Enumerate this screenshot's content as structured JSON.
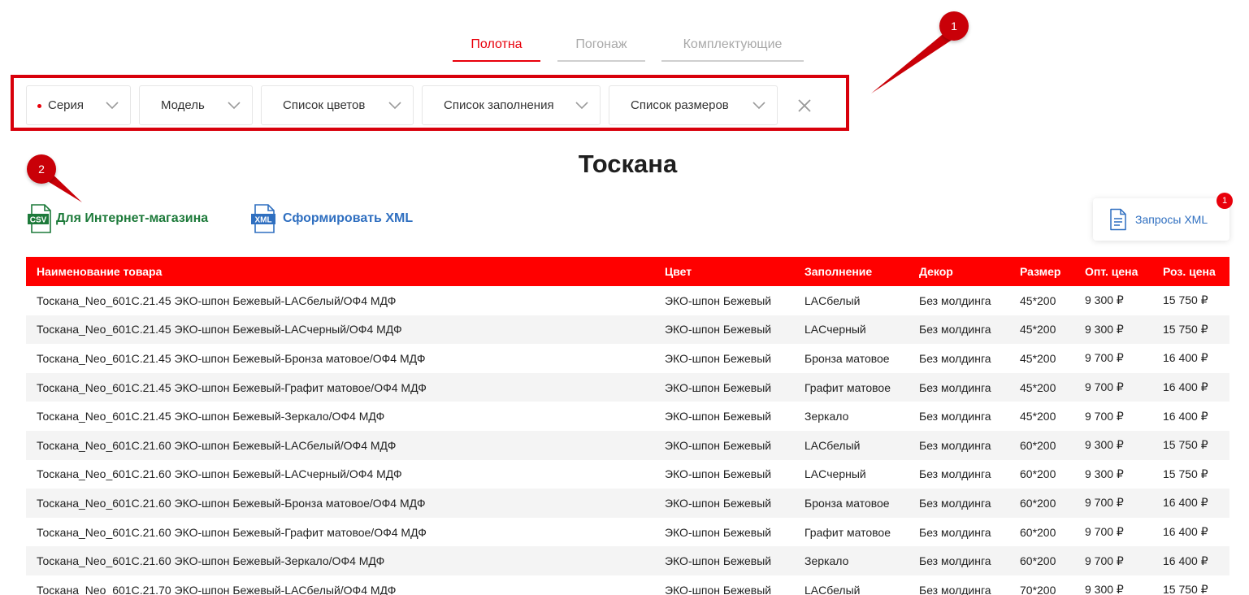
{
  "tabs": [
    {
      "label": "Полотна",
      "active": true
    },
    {
      "label": "Погонаж",
      "active": false
    },
    {
      "label": "Комплектующие",
      "active": false
    }
  ],
  "filters": [
    {
      "label": "Серия",
      "marked": true
    },
    {
      "label": "Модель",
      "marked": false
    },
    {
      "label": "Список цветов",
      "marked": false
    },
    {
      "label": "Список заполнения",
      "marked": false
    },
    {
      "label": "Список размеров",
      "marked": false
    }
  ],
  "callouts": {
    "one": "1",
    "two": "2"
  },
  "page_title": "Тоскана",
  "exports": {
    "csv": {
      "icon": "CSV",
      "label": "Для Интернет-магазина"
    },
    "xml": {
      "icon": "XML",
      "label": "Сформировать XML"
    }
  },
  "xml_requests": {
    "label": "Запросы XML",
    "badge": "1"
  },
  "colors": {
    "accent": "#e8000b",
    "header_bg": "#ff0000",
    "csv_green": "#1d7a3a",
    "xml_blue": "#2f6fc0"
  },
  "table": {
    "columns": [
      "Наименование товара",
      "Цвет",
      "Заполнение",
      "Декор",
      "Размер",
      "Опт. цена",
      "Роз. цена"
    ],
    "rows": [
      [
        "Тоскана_Neo_601C.21.45 ЭКО-шпон Бежевый-LACбелый/ОФ4 МДФ",
        "ЭКО-шпон Бежевый",
        "LACбелый",
        "Без молдинга",
        "45*200",
        "9 300 ₽",
        "15 750 ₽"
      ],
      [
        "Тоскана_Neo_601C.21.45 ЭКО-шпон Бежевый-LACчерный/ОФ4 МДФ",
        "ЭКО-шпон Бежевый",
        "LACчерный",
        "Без молдинга",
        "45*200",
        "9 300 ₽",
        "15 750 ₽"
      ],
      [
        "Тоскана_Neo_601C.21.45 ЭКО-шпон Бежевый-Бронза матовое/ОФ4 МДФ",
        "ЭКО-шпон Бежевый",
        "Бронза матовое",
        "Без молдинга",
        "45*200",
        "9 700 ₽",
        "16 400 ₽"
      ],
      [
        "Тоскана_Neo_601C.21.45 ЭКО-шпон Бежевый-Графит матовое/ОФ4 МДФ",
        "ЭКО-шпон Бежевый",
        "Графит матовое",
        "Без молдинга",
        "45*200",
        "9 700 ₽",
        "16 400 ₽"
      ],
      [
        "Тоскана_Neo_601C.21.45 ЭКО-шпон Бежевый-Зеркало/ОФ4 МДФ",
        "ЭКО-шпон Бежевый",
        "Зеркало",
        "Без молдинга",
        "45*200",
        "9 700 ₽",
        "16 400 ₽"
      ],
      [
        "Тоскана_Neo_601C.21.60 ЭКО-шпон Бежевый-LACбелый/ОФ4 МДФ",
        "ЭКО-шпон Бежевый",
        "LACбелый",
        "Без молдинга",
        "60*200",
        "9 300 ₽",
        "15 750 ₽"
      ],
      [
        "Тоскана_Neo_601C.21.60 ЭКО-шпон Бежевый-LACчерный/ОФ4 МДФ",
        "ЭКО-шпон Бежевый",
        "LACчерный",
        "Без молдинга",
        "60*200",
        "9 300 ₽",
        "15 750 ₽"
      ],
      [
        "Тоскана_Neo_601C.21.60 ЭКО-шпон Бежевый-Бронза матовое/ОФ4 МДФ",
        "ЭКО-шпон Бежевый",
        "Бронза матовое",
        "Без молдинга",
        "60*200",
        "9 700 ₽",
        "16 400 ₽"
      ],
      [
        "Тоскана_Neo_601C.21.60 ЭКО-шпон Бежевый-Графит матовое/ОФ4 МДФ",
        "ЭКО-шпон Бежевый",
        "Графит матовое",
        "Без молдинга",
        "60*200",
        "9 700 ₽",
        "16 400 ₽"
      ],
      [
        "Тоскана_Neo_601C.21.60 ЭКО-шпон Бежевый-Зеркало/ОФ4 МДФ",
        "ЭКО-шпон Бежевый",
        "Зеркало",
        "Без молдинга",
        "60*200",
        "9 700 ₽",
        "16 400 ₽"
      ],
      [
        "Тоскана_Neo_601C.21.70 ЭКО-шпон Бежевый-LACбелый/ОФ4 МДФ",
        "ЭКО-шпон Бежевый",
        "LACбелый",
        "Без молдинга",
        "70*200",
        "9 300 ₽",
        "15 750 ₽"
      ]
    ]
  }
}
